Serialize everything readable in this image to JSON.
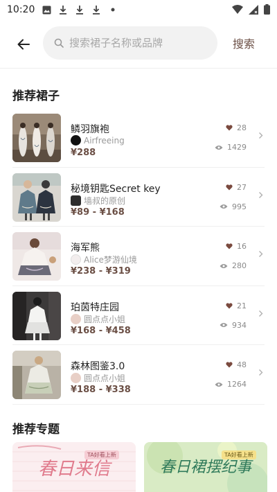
{
  "status_bar": {
    "time": "10:20"
  },
  "header": {
    "search_placeholder": "搜索裙子名称或品牌",
    "search_button": "搜索"
  },
  "sections": {
    "recommended_dresses": "推荐裙子",
    "recommended_topics": "推荐专题"
  },
  "dresses": [
    {
      "name": "鳞羽旗袍",
      "shop": "Airfreeing",
      "price": "¥288",
      "likes": "28",
      "views": "1429"
    },
    {
      "name": "秘境钥匙Secret key",
      "shop": "墙叔的原创",
      "price": "¥89 - ¥168",
      "likes": "27",
      "views": "995"
    },
    {
      "name": "海军熊",
      "shop": "Alice梦游仙境",
      "price": "¥238 - ¥319",
      "likes": "16",
      "views": "280"
    },
    {
      "name": "珀茵特庄园",
      "shop": "圆点点小姐",
      "price": "¥168 - ¥458",
      "likes": "21",
      "views": "934"
    },
    {
      "name": "森林图鉴3.0",
      "shop": "圆点点小姐",
      "price": "¥188 - ¥338",
      "likes": "48",
      "views": "1264"
    }
  ],
  "topics": [
    {
      "title": "春日来信",
      "tag": "TA好看上新"
    },
    {
      "title": "春日裙摆纪事",
      "tag": "TA好看上新"
    }
  ],
  "colors": {
    "accent": "#6b4f45",
    "heart": "#7a4a3f",
    "muted": "#9a9a9a",
    "search_bg": "#f2f2f2"
  }
}
